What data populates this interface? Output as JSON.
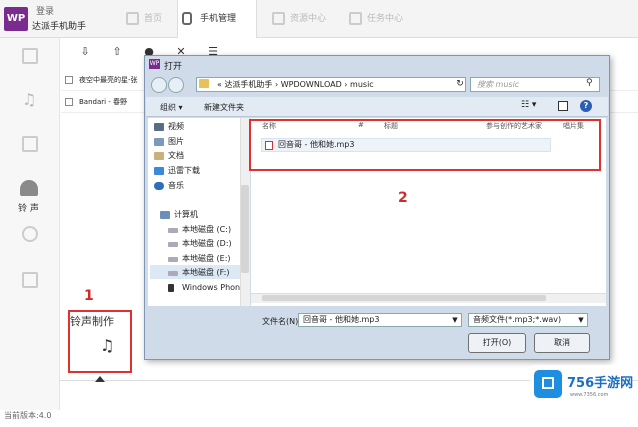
{
  "app": {
    "logo": "WP",
    "login": "登录",
    "name": "达派手机助手",
    "nav": [
      {
        "label": "首页"
      },
      {
        "label": "手机管理"
      },
      {
        "label": "资源中心"
      },
      {
        "label": "任务中心"
      }
    ],
    "sidebar_active_label": "铃 声",
    "files": [
      {
        "name": "夜空中最亮的星-张"
      },
      {
        "name": "Bandari - 春野"
      }
    ],
    "ringtone_panel_label": "铃声制作",
    "version": "当前版本:4.0"
  },
  "annotations": {
    "one": "1",
    "two": "2"
  },
  "dialog": {
    "title": "打开",
    "logo": "WP",
    "address": "« 达派手机助手 › WPDOWNLOAD › music",
    "search_placeholder": "搜索 music",
    "organize": "组织 ▾",
    "new_folder": "新建文件夹",
    "nav_items": [
      {
        "label": "视频",
        "icon": "video-folder-icon"
      },
      {
        "label": "图片",
        "icon": "pictures-folder-icon"
      },
      {
        "label": "文档",
        "icon": "documents-folder-icon"
      },
      {
        "label": "迅雷下载",
        "icon": "download-folder-icon"
      },
      {
        "label": "音乐",
        "icon": "music-folder-icon"
      },
      {
        "label": "计算机",
        "icon": "computer-icon"
      },
      {
        "label": "本地磁盘 (C:)",
        "icon": "drive-icon"
      },
      {
        "label": "本地磁盘 (D:)",
        "icon": "drive-icon"
      },
      {
        "label": "本地磁盘 (E:)",
        "icon": "drive-icon"
      },
      {
        "label": "本地磁盘 (F:)",
        "icon": "drive-icon"
      },
      {
        "label": "Windows Phone",
        "icon": "phone-icon"
      }
    ],
    "columns": [
      "名称",
      "#",
      "标题",
      "参与创作的艺术家",
      "唱片集"
    ],
    "file": "回音哥 - 他和她.mp3",
    "filename_label": "文件名(N):",
    "filename_value": "回音哥 - 他和她.mp3",
    "filetype": "音频文件(*.mp3;*.wav)",
    "open_button": "打开(O)",
    "cancel_button": "取消"
  },
  "watermark": {
    "text": "756手游网",
    "url": "www.7356.com"
  },
  "colors": {
    "brand": "#7a2c8e",
    "annotation": "#e03030",
    "watermark": "#1e8fe0"
  }
}
